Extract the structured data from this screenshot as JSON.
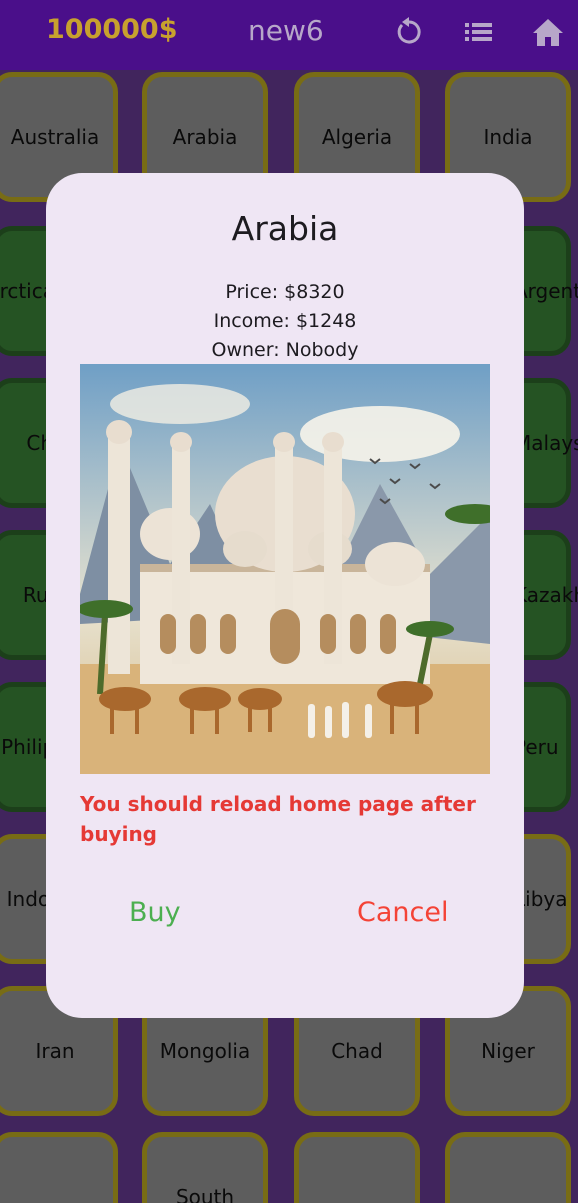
{
  "header": {
    "balance": "100000$",
    "username": "new6",
    "icons": [
      "refresh-icon",
      "list-icon",
      "home-icon"
    ]
  },
  "tiles": [
    [
      "Australia",
      "Arabia",
      "Algeria",
      "India"
    ],
    [
      "Antarctica",
      "",
      "",
      "Argentina"
    ],
    [
      "China",
      "",
      "",
      "Malaysia"
    ],
    [
      "Russia",
      "",
      "",
      "Kazakhstan"
    ],
    [
      "Philippines",
      "",
      "",
      "Peru"
    ],
    [
      "Indonesia",
      "",
      "",
      "Libya"
    ],
    [
      "Iran",
      "Mongolia",
      "Chad",
      "Niger"
    ],
    [
      "",
      "South",
      "",
      ""
    ]
  ],
  "dialog": {
    "title": "Arabia",
    "price": "Price: $8320",
    "income": "Income: $1248",
    "owner": "Owner: Nobody",
    "image_alt": "mosque-with-camels-illustration",
    "warning": "You should reload home page after buying",
    "buy_label": "Buy",
    "cancel_label": "Cancel"
  },
  "colors": {
    "topbar": "#4a0f8a",
    "balance": "#c8a12e",
    "tile_unowned": "#9b9b9b",
    "tile_owned": "#3f8a3b",
    "tile_border": "#c9b423",
    "dialog_bg": "#efe6f4",
    "warning": "#e53935",
    "buy": "#4caf50",
    "cancel": "#f44336"
  }
}
